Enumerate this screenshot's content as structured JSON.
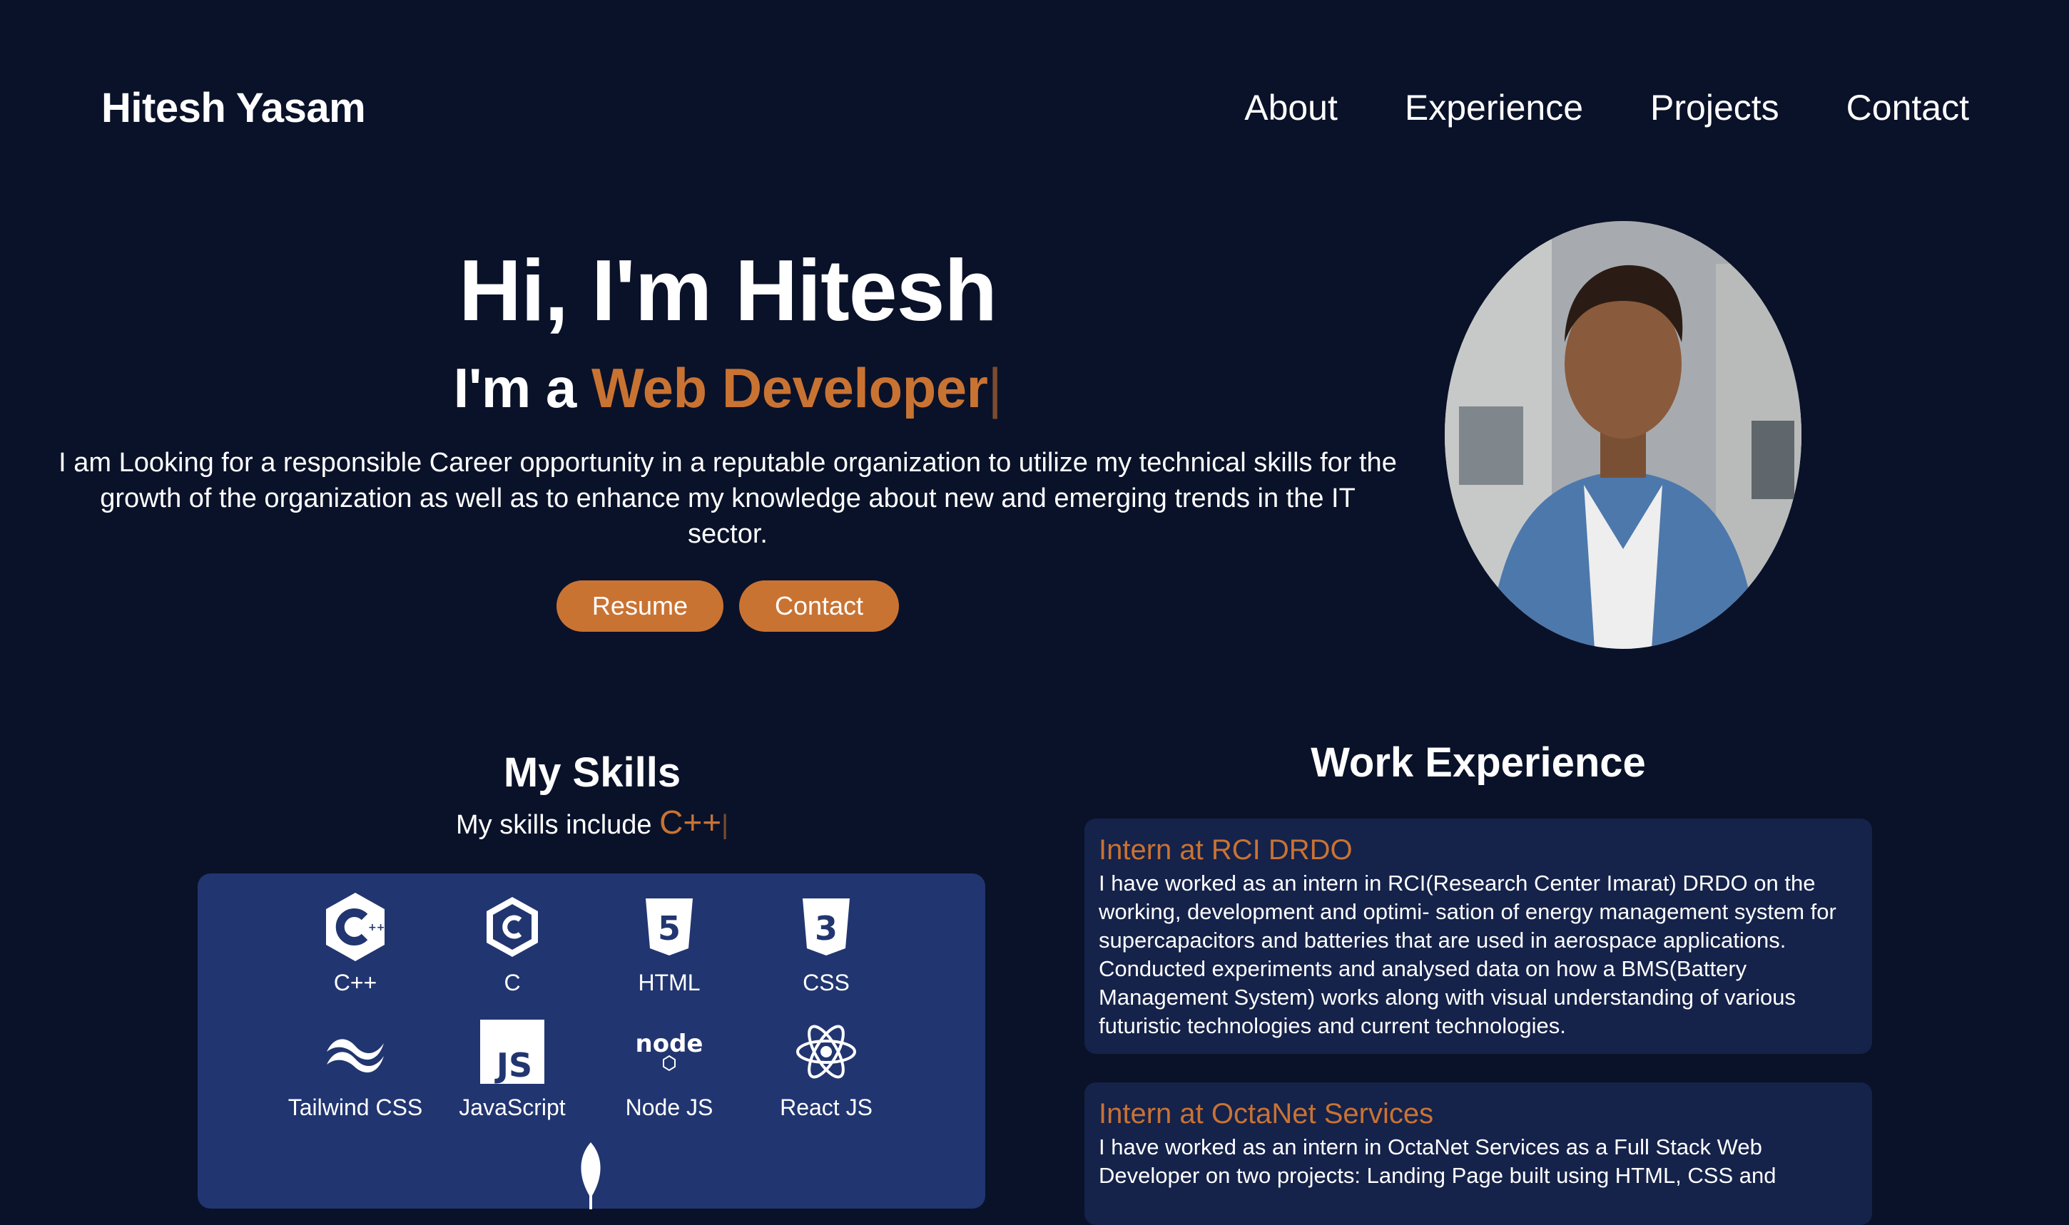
{
  "nav": {
    "brand": "Hitesh Yasam",
    "links": [
      "About",
      "Experience",
      "Projects",
      "Contact"
    ]
  },
  "hero": {
    "title": "Hi, I'm Hitesh",
    "sub_prefix": "I'm a",
    "sub_role": "Web Developer",
    "cursor": "|",
    "desc": "I am Looking for a responsible Career opportunity in a reputable organization to utilize my technical skills for the growth of the organization as well as to enhance my knowledge about new and emerging trends in the IT sector.",
    "btn_resume": "Resume",
    "btn_contact": "Contact"
  },
  "skills": {
    "title": "My Skills",
    "sub_prefix": "My skills include",
    "sub_value": "C++",
    "cursor": "|",
    "items": [
      "C++",
      "C",
      "HTML",
      "CSS",
      "Tailwind CSS",
      "JavaScript",
      "Node JS",
      "React JS"
    ],
    "icons": [
      "cpp-icon",
      "c-icon",
      "html5-icon",
      "css3-icon",
      "tailwind-icon",
      "javascript-icon",
      "nodejs-icon",
      "react-icon",
      "mongodb-icon"
    ]
  },
  "experience": {
    "title": "Work Experience",
    "items": [
      {
        "title": "Intern at RCI DRDO",
        "desc": "I have worked as an intern in RCI(Research Center Imarat) DRDO on the working, development and optimi- sation of energy management system for supercapacitors and batteries that are used in aerospace applications. Conducted experiments and analysed data on how a BMS(Battery Management System) works along with visual understanding of various futuristic technologies and current technologies."
      },
      {
        "title": "Intern at OctaNet Services",
        "desc": "I have worked as an intern in OctaNet Services as a Full Stack Web Developer on two projects: Landing Page built using HTML, CSS and"
      }
    ]
  },
  "colors": {
    "background": "#0a1229",
    "accent": "#c97333",
    "panel": "#213570",
    "card": "#15224a"
  }
}
